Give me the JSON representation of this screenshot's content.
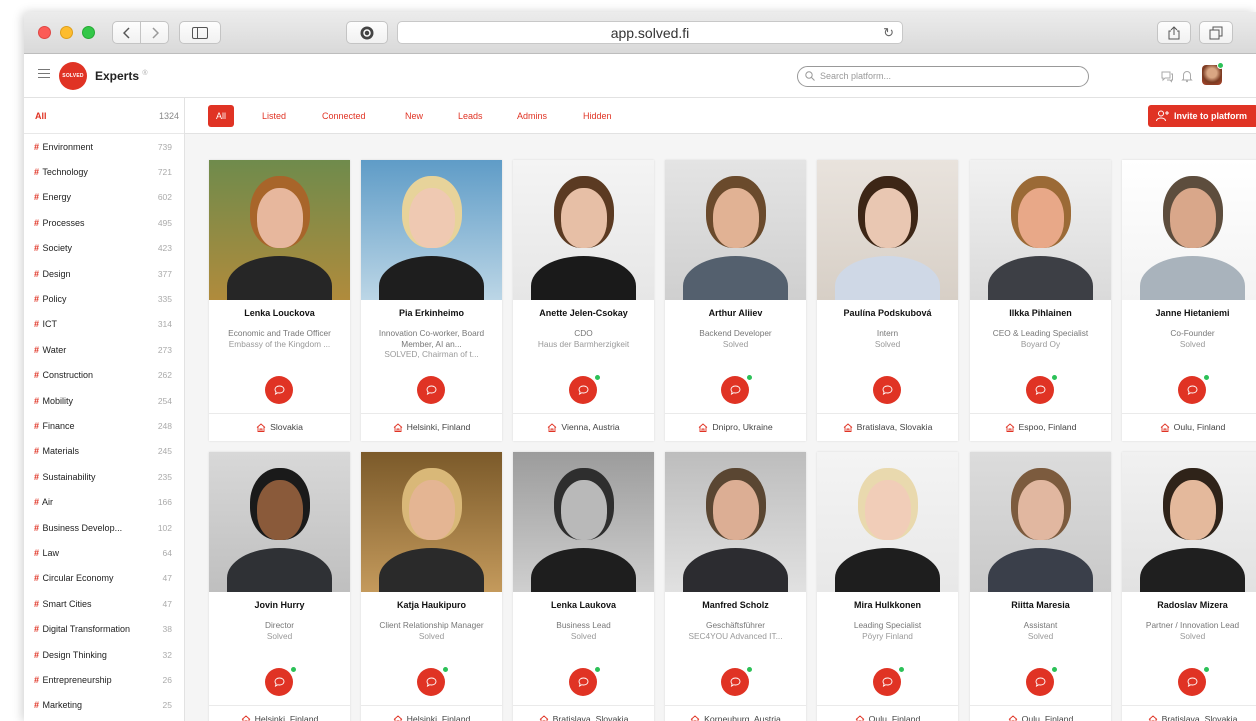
{
  "browser": {
    "url": "app.solved.fi"
  },
  "header": {
    "logo_text": "SOLVED",
    "title": "Experts",
    "title_sup": "®",
    "search_placeholder": "Search platform..."
  },
  "sidebar": {
    "all_label": "All",
    "all_count": "1324",
    "items": [
      {
        "label": "Environment",
        "count": "739"
      },
      {
        "label": "Technology",
        "count": "721"
      },
      {
        "label": "Energy",
        "count": "602"
      },
      {
        "label": "Processes",
        "count": "495"
      },
      {
        "label": "Society",
        "count": "423"
      },
      {
        "label": "Design",
        "count": "377"
      },
      {
        "label": "Policy",
        "count": "335"
      },
      {
        "label": "ICT",
        "count": "314"
      },
      {
        "label": "Water",
        "count": "273"
      },
      {
        "label": "Construction",
        "count": "262"
      },
      {
        "label": "Mobility",
        "count": "254"
      },
      {
        "label": "Finance",
        "count": "248"
      },
      {
        "label": "Materials",
        "count": "245"
      },
      {
        "label": "Sustainability",
        "count": "235"
      },
      {
        "label": "Air",
        "count": "166"
      },
      {
        "label": "Business Develop...",
        "count": "102"
      },
      {
        "label": "Law",
        "count": "64"
      },
      {
        "label": "Circular Economy",
        "count": "47"
      },
      {
        "label": "Smart Cities",
        "count": "47"
      },
      {
        "label": "Digital Transformation",
        "count": "38"
      },
      {
        "label": "Design Thinking",
        "count": "32"
      },
      {
        "label": "Entrepreneurship",
        "count": "26"
      },
      {
        "label": "Marketing",
        "count": "25"
      }
    ]
  },
  "filters": {
    "tabs": [
      "All",
      "Listed",
      "Connected",
      "New",
      "Leads",
      "Admins",
      "Hidden"
    ],
    "invite_label": "Invite to platform"
  },
  "experts": [
    {
      "name": "Lenka Louckova",
      "role": "Economic and Trade Officer",
      "org": "Embassy of the Kingdom ...",
      "location": "Slovakia",
      "online": false
    },
    {
      "name": "Pia Erkinheimo",
      "role": "Innovation Co-worker, Board Member, AI an...",
      "org": "SOLVED, Chairman of t...",
      "location": "Helsinki, Finland",
      "online": false
    },
    {
      "name": "Anette Jelen-Csokay",
      "role": "CDO",
      "org": "Haus der Barmherzigkeit",
      "location": "Vienna, Austria",
      "online": true
    },
    {
      "name": "Arthur Aliiev",
      "role": "Backend Developer",
      "org": "Solved",
      "location": "Dnipro, Ukraine",
      "online": true
    },
    {
      "name": "Paulína Podskubová",
      "role": "Intern",
      "org": "Solved",
      "location": "Bratislava, Slovakia",
      "online": false
    },
    {
      "name": "Ilkka Pihlainen",
      "role": "CEO & Leading Specialist",
      "org": "Boyard Oy",
      "location": "Espoo, Finland",
      "online": true
    },
    {
      "name": "Janne Hietaniemi",
      "role": "Co-Founder",
      "org": "Solved",
      "location": "Oulu, Finland",
      "online": true
    },
    {
      "name": "Jovin Hurry",
      "role": "Director",
      "org": "Solved",
      "location": "Helsinki, Finland",
      "online": true
    },
    {
      "name": "Katja Haukipuro",
      "role": "Client Relationship Manager",
      "org": "Solved",
      "location": "Helsinki, Finland",
      "online": true
    },
    {
      "name": "Lenka Laukova",
      "role": "Business Lead",
      "org": "Solved",
      "location": "Bratislava, Slovakia",
      "online": true
    },
    {
      "name": "Manfred Scholz",
      "role": "Geschäftsführer",
      "org": "SEC4YOU Advanced IT...",
      "location": "Korneuburg, Austria",
      "online": true
    },
    {
      "name": "Mira Hulkkonen",
      "role": "Leading Specialist",
      "org": "Pöyry Finland",
      "location": "Oulu, Finland",
      "online": true
    },
    {
      "name": "Riitta Maresia",
      "role": "Assistant",
      "org": "Solved",
      "location": "Oulu, Finland",
      "online": true
    },
    {
      "name": "Radoslav Mizera",
      "role": "Partner / Innovation Lead",
      "org": "Solved",
      "location": "Bratislava, Slovakia",
      "online": true
    }
  ],
  "icons": {
    "accent": "#e03324",
    "online": "#2cc158"
  }
}
